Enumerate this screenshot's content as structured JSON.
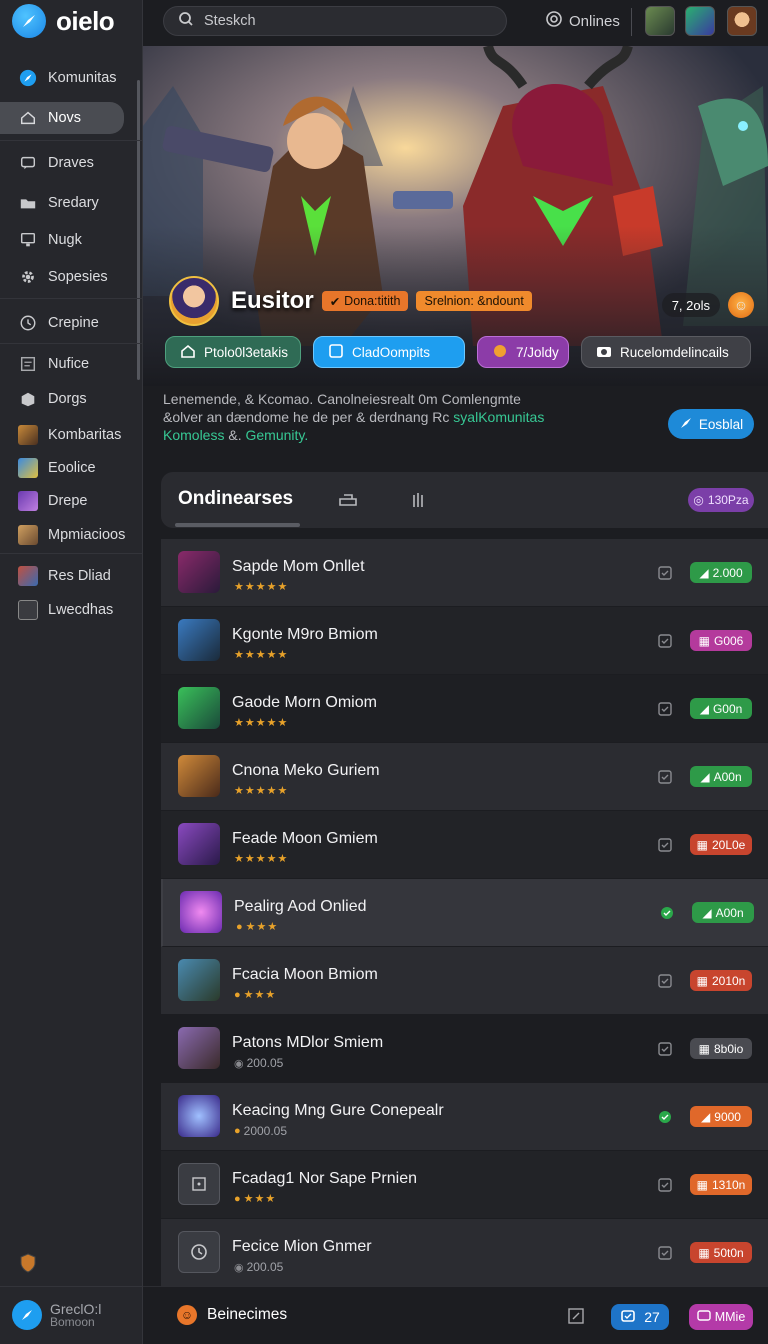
{
  "app": {
    "logo_text": "oielo"
  },
  "sidebar": {
    "items": [
      {
        "label": "Komunitas",
        "icon": "compass-icon"
      },
      {
        "label": "Novs",
        "icon": "home-icon",
        "active": true
      },
      {
        "label": "Draves",
        "icon": "chat-icon"
      },
      {
        "label": "Sredary",
        "icon": "folder-icon"
      },
      {
        "label": "Nugk",
        "icon": "monitor-icon"
      },
      {
        "label": "Sopesies",
        "icon": "gear-icon"
      },
      {
        "label": "Crepine",
        "icon": "clock-icon"
      },
      {
        "label": "Nufice",
        "icon": "document-icon"
      },
      {
        "label": "Dorgs",
        "icon": "box-icon"
      },
      {
        "label": "Kombaritas",
        "icon": "game-thumb-icon"
      },
      {
        "label": "Eoolice",
        "icon": "game-thumb-icon"
      },
      {
        "label": "Drepe",
        "icon": "game-thumb-icon"
      },
      {
        "label": "Mpmiacioos",
        "icon": "game-thumb-icon"
      },
      {
        "label": "Res Dliad",
        "icon": "game-thumb-icon"
      },
      {
        "label": "Lwecdhas",
        "icon": "game-thumb-icon"
      }
    ],
    "footer_line1": "GreclO:l",
    "footer_line2": "Bomoon"
  },
  "topbar": {
    "search_placeholder": "Steskch",
    "online_label": "Onlines"
  },
  "hero": {
    "title": "Eusitor",
    "tag1": "Dona:titith",
    "tag2": "Srelnion: &ndount",
    "count": "7, 2ols",
    "buttons": [
      {
        "label": "Ptolo0l3etakis"
      },
      {
        "label": "CladOompits"
      },
      {
        "label": "7/Joldy"
      },
      {
        "label": "Rucelomdelincails"
      }
    ]
  },
  "description": {
    "line1": "Lenemende, & Kcomao. Canolneiesrealt 0m Comlengmte",
    "line2a": "&olver an dændome he de per & derdnang Rc ",
    "line2_highlight": "syalKomunitas",
    "line3_highlight": "Komoless",
    "line3b": " &. ",
    "line3_highlight2": "Gemunity.",
    "enroll_label": "Eosblal"
  },
  "tabs": {
    "title": "Ondinearses",
    "badge": "130Pza"
  },
  "list": [
    {
      "title": "Sapde Mom Onllet",
      "sub_stars": "★★★★★",
      "sub_num": "",
      "pill": "2.000",
      "pill_color": "green",
      "check": "gray"
    },
    {
      "title": "Kgonte M9ro Bmiom",
      "sub_stars": "★★★★★",
      "sub_num": "",
      "pill": "G006",
      "pill_color": "magenta",
      "check": "gray"
    },
    {
      "title": "Gaode Morn Omiom",
      "sub_stars": "★★★★★",
      "sub_num": "",
      "pill": "G00n",
      "pill_color": "green",
      "check": "gray"
    },
    {
      "title": "Cnona Meko Guriem",
      "sub_stars": "★★★★★",
      "sub_num": "",
      "pill": "A00n",
      "pill_color": "green",
      "check": "gray"
    },
    {
      "title": "Feade Moon Gmiem",
      "sub_stars": "★★★★★",
      "sub_num": "",
      "pill": "20L0e",
      "pill_color": "red",
      "check": "gray"
    },
    {
      "title": "Pealirg Aod Onlied",
      "sub_stars": "★★★",
      "sub_num": "",
      "pill": "A00n",
      "pill_color": "green",
      "check": "green",
      "coin": true
    },
    {
      "title": "Fcacia Moon Bmiom",
      "sub_stars": "★★★",
      "sub_num": "",
      "pill": "2010n",
      "pill_color": "red",
      "check": "gray",
      "coin": true
    },
    {
      "title": "Patons MDlor Smiem",
      "sub_stars": "",
      "sub_num": "200.05",
      "pill": "8b0io",
      "pill_color": "gray",
      "check": "gray",
      "coin": true
    },
    {
      "title": "Keacing Mng Gure Conepealr",
      "sub_stars": "",
      "sub_num": "2000.05",
      "pill": "9000",
      "pill_color": "orange",
      "check": "green",
      "coin": true
    },
    {
      "title": "Fcadag1 Nor Sape Prnien",
      "sub_stars": "★★★",
      "sub_num": "",
      "pill": "1310n",
      "pill_color": "orange",
      "check": "gray",
      "coin": true
    },
    {
      "title": "Fecice Mion Gnmer",
      "sub_stars": "",
      "sub_num": "200.05",
      "pill": "50t0n",
      "pill_color": "red",
      "check": "gray",
      "coin": true
    }
  ],
  "bottombar": {
    "label": "Beinecimes",
    "count1": "27",
    "count2": "MMie"
  },
  "colors": {
    "accent": "#1e9ef0",
    "active_bg": "#4a4c52",
    "green": "#2e9a48",
    "magenta": "#b43a9c",
    "red": "#c8452e",
    "orange": "#e0682a"
  }
}
